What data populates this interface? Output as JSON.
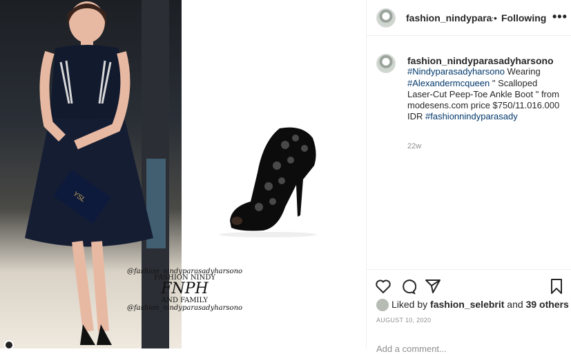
{
  "header": {
    "username": "fashion_nindyparasadyharsono",
    "separator": "•",
    "follow_label": "Following",
    "more_label": "•••"
  },
  "caption": {
    "username": "fashion_nindyparasadyharsono",
    "tag1": "#Nindyparasadyharsono",
    "text1": " Wearing ",
    "tag2": "#Alexandermcqueen",
    "text2": " \" Scalloped Laser-Cut Peep-Toe Ankle Boot \" from modesens.com price $750/11.016.000 IDR ",
    "tag3": "#fashionnindyparasady",
    "time_ago": "22w"
  },
  "photo": {
    "watermark_script1": "@fashion_nindyparasadyharsono",
    "watermark_line1": "FASHION NINDY",
    "watermark_logo": "FNPH",
    "watermark_line2": "AND FAMILY",
    "watermark_script2": "@fashion_nindyparasadyharsono",
    "clutch_logo": "YSL"
  },
  "likes": {
    "prefix": "Liked by ",
    "user": "fashion_selebrit",
    "middle": " and ",
    "others": "39 others"
  },
  "date": "AUGUST 10, 2020",
  "comment_placeholder": "Add a comment..."
}
